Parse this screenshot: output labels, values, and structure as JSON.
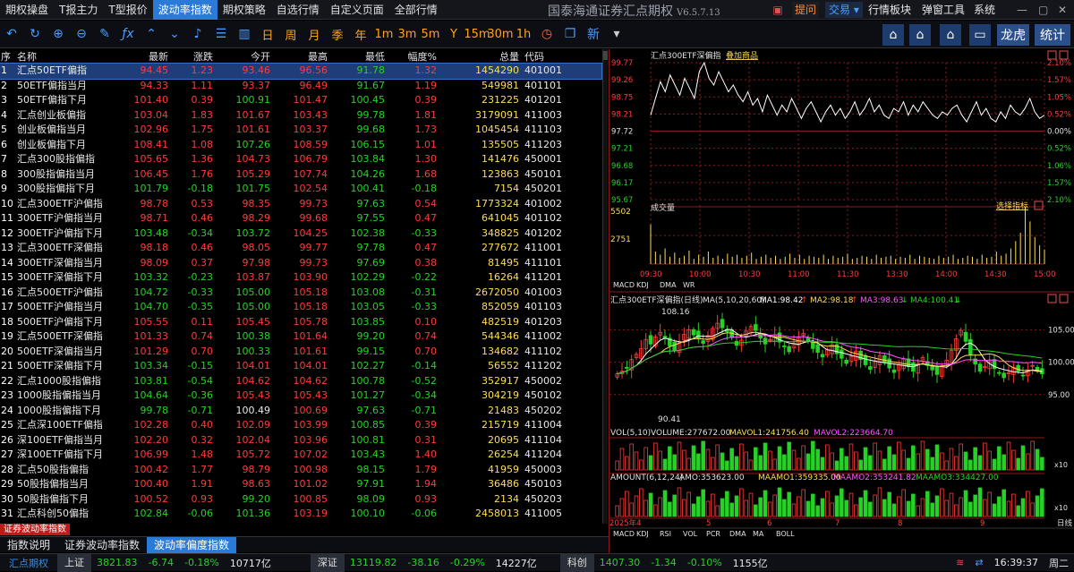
{
  "menubar": {
    "items": [
      "期权操盘",
      "T报主力",
      "T型报价",
      "波动率指数",
      "期权策略",
      "自选行情",
      "自定义页面",
      "全部行情"
    ],
    "active_index": 3
  },
  "app_title": {
    "name": "国泰海通证券汇点期权",
    "version": "V6.5.7.13"
  },
  "right_menu": {
    "tixing": "提问",
    "jiaoyi": "交易",
    "hangqing_bankuai": "行情板块",
    "tanchuang": "弹窗工具",
    "xitong": "系统"
  },
  "toolbar": {
    "periods": [
      "日",
      "周",
      "月",
      "季",
      "年",
      "1m",
      "3m",
      "5m",
      "Y",
      "15m",
      "30m",
      "1h"
    ],
    "xin_label": "新",
    "longhu_label": "龙虎",
    "tongji_label": "统计",
    "icons": [
      "undo-icon",
      "refresh-icon",
      "zoom-in-icon",
      "zoom-out-icon",
      "draw-icon",
      "formula-icon",
      "up-icon",
      "down-icon",
      "bell-icon",
      "list-icon",
      "chart-icon"
    ]
  },
  "table": {
    "headers": {
      "no": "序",
      "name": "名称",
      "last": "最新",
      "chg": "涨跌",
      "open": "今开",
      "high": "最高",
      "low": "最低",
      "pct": "幅度%",
      "vol": "总量",
      "code": "代码"
    },
    "rows": [
      {
        "no": "1",
        "name": "汇点50ETF偏指",
        "last": "94.45",
        "chg": "1.23",
        "open": "93.46",
        "high": "96.56",
        "low": "91.78",
        "pct": "1.32",
        "vol": "1454290",
        "code": "401001",
        "dir": "up",
        "o": "up",
        "h": "up",
        "l": "dn"
      },
      {
        "no": "2",
        "name": "50ETF偏指当月",
        "last": "94.33",
        "chg": "1.11",
        "open": "93.37",
        "high": "96.49",
        "low": "91.67",
        "pct": "1.19",
        "vol": "549981",
        "code": "401101",
        "dir": "up",
        "o": "up",
        "h": "up",
        "l": "dn"
      },
      {
        "no": "3",
        "name": "50ETF偏指下月",
        "last": "101.40",
        "chg": "0.39",
        "open": "100.91",
        "high": "101.47",
        "low": "100.45",
        "pct": "0.39",
        "vol": "231225",
        "code": "401201",
        "dir": "up",
        "o": "dn",
        "h": "up",
        "l": "dn"
      },
      {
        "no": "4",
        "name": "汇点创业板偏指",
        "last": "103.04",
        "chg": "1.83",
        "open": "101.67",
        "high": "103.43",
        "low": "99.78",
        "pct": "1.81",
        "vol": "3179091",
        "code": "411003",
        "dir": "up",
        "o": "up",
        "h": "up",
        "l": "dn"
      },
      {
        "no": "5",
        "name": "创业板偏指当月",
        "last": "102.96",
        "chg": "1.75",
        "open": "101.61",
        "high": "103.37",
        "low": "99.68",
        "pct": "1.73",
        "vol": "1045454",
        "code": "411103",
        "dir": "up",
        "o": "up",
        "h": "up",
        "l": "dn"
      },
      {
        "no": "6",
        "name": "创业板偏指下月",
        "last": "108.41",
        "chg": "1.08",
        "open": "107.26",
        "high": "108.59",
        "low": "106.15",
        "pct": "1.01",
        "vol": "135505",
        "code": "411203",
        "dir": "up",
        "o": "dn",
        "h": "up",
        "l": "dn"
      },
      {
        "no": "7",
        "name": "汇点300股指偏指",
        "last": "105.65",
        "chg": "1.36",
        "open": "104.73",
        "high": "106.79",
        "low": "103.84",
        "pct": "1.30",
        "vol": "141476",
        "code": "450001",
        "dir": "up",
        "o": "up",
        "h": "up",
        "l": "dn"
      },
      {
        "no": "8",
        "name": "300股指偏指当月",
        "last": "106.45",
        "chg": "1.76",
        "open": "105.29",
        "high": "107.74",
        "low": "104.26",
        "pct": "1.68",
        "vol": "123863",
        "code": "450101",
        "dir": "up",
        "o": "up",
        "h": "up",
        "l": "dn"
      },
      {
        "no": "9",
        "name": "300股指偏指下月",
        "last": "101.79",
        "chg": "-0.18",
        "open": "101.75",
        "high": "102.54",
        "low": "100.41",
        "pct": "-0.18",
        "vol": "7154",
        "code": "450201",
        "dir": "dn",
        "o": "dn",
        "h": "up",
        "l": "dn"
      },
      {
        "no": "10",
        "name": "汇点300ETF沪偏指",
        "last": "98.78",
        "chg": "0.53",
        "open": "98.35",
        "high": "99.73",
        "low": "97.63",
        "pct": "0.54",
        "vol": "1773324",
        "code": "401002",
        "dir": "up",
        "o": "up",
        "h": "up",
        "l": "dn"
      },
      {
        "no": "11",
        "name": "300ETF沪偏指当月",
        "last": "98.71",
        "chg": "0.46",
        "open": "98.29",
        "high": "99.68",
        "low": "97.55",
        "pct": "0.47",
        "vol": "641045",
        "code": "401102",
        "dir": "up",
        "o": "up",
        "h": "up",
        "l": "dn"
      },
      {
        "no": "12",
        "name": "300ETF沪偏指下月",
        "last": "103.48",
        "chg": "-0.34",
        "open": "103.72",
        "high": "104.25",
        "low": "102.38",
        "pct": "-0.33",
        "vol": "348825",
        "code": "401202",
        "dir": "dn",
        "o": "dn",
        "h": "up",
        "l": "dn"
      },
      {
        "no": "13",
        "name": "汇点300ETF深偏指",
        "last": "98.18",
        "chg": "0.46",
        "open": "98.05",
        "high": "99.77",
        "low": "97.78",
        "pct": "0.47",
        "vol": "277672",
        "code": "411001",
        "dir": "up",
        "o": "up",
        "h": "up",
        "l": "dn"
      },
      {
        "no": "14",
        "name": "300ETF深偏指当月",
        "last": "98.09",
        "chg": "0.37",
        "open": "97.98",
        "high": "99.73",
        "low": "97.69",
        "pct": "0.38",
        "vol": "81495",
        "code": "411101",
        "dir": "up",
        "o": "up",
        "h": "up",
        "l": "dn"
      },
      {
        "no": "15",
        "name": "300ETF深偏指下月",
        "last": "103.32",
        "chg": "-0.23",
        "open": "103.87",
        "high": "103.90",
        "low": "102.29",
        "pct": "-0.22",
        "vol": "16264",
        "code": "411201",
        "dir": "dn",
        "o": "up",
        "h": "up",
        "l": "dn"
      },
      {
        "no": "16",
        "name": "汇点500ETF沪偏指",
        "last": "104.72",
        "chg": "-0.33",
        "open": "105.00",
        "high": "105.18",
        "low": "103.08",
        "pct": "-0.31",
        "vol": "2672050",
        "code": "401003",
        "dir": "dn",
        "o": "dn",
        "h": "up",
        "l": "dn"
      },
      {
        "no": "17",
        "name": "500ETF沪偏指当月",
        "last": "104.70",
        "chg": "-0.35",
        "open": "105.00",
        "high": "105.18",
        "low": "103.05",
        "pct": "-0.33",
        "vol": "852059",
        "code": "401103",
        "dir": "dn",
        "o": "dn",
        "h": "up",
        "l": "dn"
      },
      {
        "no": "18",
        "name": "500ETF沪偏指下月",
        "last": "105.55",
        "chg": "0.11",
        "open": "105.45",
        "high": "105.78",
        "low": "103.85",
        "pct": "0.10",
        "vol": "482519",
        "code": "401203",
        "dir": "up",
        "o": "up",
        "h": "up",
        "l": "dn"
      },
      {
        "no": "19",
        "name": "汇点500ETF深偏指",
        "last": "101.33",
        "chg": "0.74",
        "open": "100.38",
        "high": "101.64",
        "low": "99.20",
        "pct": "0.74",
        "vol": "544346",
        "code": "411002",
        "dir": "up",
        "o": "dn",
        "h": "up",
        "l": "dn"
      },
      {
        "no": "20",
        "name": "500ETF深偏指当月",
        "last": "101.29",
        "chg": "0.70",
        "open": "100.33",
        "high": "101.61",
        "low": "99.15",
        "pct": "0.70",
        "vol": "134682",
        "code": "411102",
        "dir": "up",
        "o": "dn",
        "h": "up",
        "l": "dn"
      },
      {
        "no": "21",
        "name": "500ETF深偏指下月",
        "last": "103.34",
        "chg": "-0.15",
        "open": "104.01",
        "high": "104.01",
        "low": "102.27",
        "pct": "-0.14",
        "vol": "56552",
        "code": "411202",
        "dir": "dn",
        "o": "up",
        "h": "up",
        "l": "dn"
      },
      {
        "no": "22",
        "name": "汇点1000股指偏指",
        "last": "103.81",
        "chg": "-0.54",
        "open": "104.62",
        "high": "104.62",
        "low": "100.78",
        "pct": "-0.52",
        "vol": "352917",
        "code": "450002",
        "dir": "dn",
        "o": "up",
        "h": "up",
        "l": "dn"
      },
      {
        "no": "23",
        "name": "1000股指偏指当月",
        "last": "104.64",
        "chg": "-0.36",
        "open": "105.43",
        "high": "105.43",
        "low": "101.27",
        "pct": "-0.34",
        "vol": "304219",
        "code": "450102",
        "dir": "dn",
        "o": "up",
        "h": "up",
        "l": "dn"
      },
      {
        "no": "24",
        "name": "1000股指偏指下月",
        "last": "99.78",
        "chg": "-0.71",
        "open": "100.49",
        "high": "100.69",
        "low": "97.63",
        "pct": "-0.71",
        "vol": "21483",
        "code": "450202",
        "dir": "dn",
        "o": "eq",
        "h": "up",
        "l": "dn"
      },
      {
        "no": "25",
        "name": "汇点深100ETF偏指",
        "last": "102.28",
        "chg": "0.40",
        "open": "102.09",
        "high": "103.99",
        "low": "100.85",
        "pct": "0.39",
        "vol": "215719",
        "code": "411004",
        "dir": "up",
        "o": "up",
        "h": "up",
        "l": "dn"
      },
      {
        "no": "26",
        "name": "深100ETF偏指当月",
        "last": "102.20",
        "chg": "0.32",
        "open": "102.04",
        "high": "103.96",
        "low": "100.81",
        "pct": "0.31",
        "vol": "20695",
        "code": "411104",
        "dir": "up",
        "o": "up",
        "h": "up",
        "l": "dn"
      },
      {
        "no": "27",
        "name": "深100ETF偏指下月",
        "last": "106.99",
        "chg": "1.48",
        "open": "105.72",
        "high": "107.02",
        "low": "103.43",
        "pct": "1.40",
        "vol": "26254",
        "code": "411204",
        "dir": "up",
        "o": "up",
        "h": "up",
        "l": "dn"
      },
      {
        "no": "28",
        "name": "汇点50股指偏指",
        "last": "100.42",
        "chg": "1.77",
        "open": "98.79",
        "high": "100.98",
        "low": "98.15",
        "pct": "1.79",
        "vol": "41959",
        "code": "450003",
        "dir": "up",
        "o": "up",
        "h": "up",
        "l": "dn"
      },
      {
        "no": "29",
        "name": "50股指偏指当月",
        "last": "100.40",
        "chg": "1.91",
        "open": "98.63",
        "high": "101.02",
        "low": "97.91",
        "pct": "1.94",
        "vol": "36486",
        "code": "450103",
        "dir": "up",
        "o": "up",
        "h": "up",
        "l": "dn"
      },
      {
        "no": "30",
        "name": "50股指偏指下月",
        "last": "100.52",
        "chg": "0.93",
        "open": "99.20",
        "high": "100.85",
        "low": "98.09",
        "pct": "0.93",
        "vol": "2134",
        "code": "450203",
        "dir": "up",
        "o": "dn",
        "h": "up",
        "l": "dn"
      },
      {
        "no": "31",
        "name": "汇点科创50偏指",
        "last": "102.84",
        "chg": "-0.06",
        "open": "101.36",
        "high": "103.19",
        "low": "100.10",
        "pct": "-0.06",
        "vol": "2458013",
        "code": "411005",
        "dir": "dn",
        "o": "dn",
        "h": "up",
        "l": "dn"
      }
    ]
  },
  "bottom_tab": "证券波动率指数",
  "info_tabs": [
    "指数说明",
    "证券波动率指数",
    "波动率偏度指数"
  ],
  "info_tabs_active": 2,
  "statusbar": {
    "logo": "汇点期权",
    "markets": [
      {
        "label": "上证",
        "value": "3821.83",
        "chg": "-6.74",
        "pct": "-0.18%",
        "amount": "10717亿"
      },
      {
        "label": "深证",
        "value": "13119.82",
        "chg": "-38.16",
        "pct": "-0.29%",
        "amount": "14227亿"
      },
      {
        "label": "科创",
        "value": "1407.30",
        "chg": "-1.34",
        "pct": "-0.10%",
        "amount": "1155亿"
      }
    ],
    "time": "16:39:37",
    "weekday": "周二"
  },
  "intraday": {
    "title": "汇点300ETF深偏指",
    "add_label": "叠加商品",
    "y_labels": [
      "99.77",
      "99.26",
      "98.75",
      "98.21",
      "97.72",
      "97.21",
      "96.68",
      "96.17",
      "95.67"
    ],
    "y_pct_labels": [
      "2.10%",
      "1.57%",
      "1.05%",
      "0.52%",
      "0.00%",
      "0.52%",
      "1.06%",
      "1.57%",
      "2.10%"
    ],
    "price": [
      98.2,
      98.7,
      99.2,
      98.9,
      99.4,
      99.1,
      98.8,
      99.3,
      99.0,
      98.7,
      99.5,
      99.77,
      99.3,
      99.1,
      99.5,
      99.2,
      98.9,
      99.1,
      98.8,
      98.6,
      98.9,
      98.5,
      98.7,
      98.3,
      98.8,
      98.5,
      98.2,
      98.5,
      98.3,
      98.7,
      98.4,
      98.1,
      98.4,
      98.6,
      98.3,
      98.0,
      98.3,
      98.5,
      98.2,
      98.4,
      98.1,
      98.3,
      98.6,
      98.2,
      98.4,
      98.7,
      98.3,
      98.5,
      98.2,
      98.1,
      98.4,
      98.3,
      98.6,
      98.2,
      98.5,
      98.3,
      98.6,
      98.4,
      98.2,
      98.1,
      98.3,
      98.2,
      98.4,
      98.5,
      98.2,
      98.0,
      98.3,
      98.6,
      98.2,
      98.4,
      98.1,
      98.0,
      98.3,
      98.1,
      98.5,
      98.3,
      98.2,
      98.4,
      98.7,
      98.3,
      98.1,
      98.2
    ],
    "vol_title": "成交量",
    "vol_select": "选择指标",
    "vol_max": "5502",
    "vol_mid": "2751",
    "vol_values": [
      3800,
      1200,
      900,
      1500,
      700,
      1100,
      600,
      800,
      1300,
      500,
      900,
      700,
      1200,
      600,
      800,
      500,
      1000,
      700,
      900,
      600,
      800,
      1100,
      500,
      700,
      900,
      600,
      800,
      500,
      700,
      1000,
      600,
      900,
      500,
      800,
      700,
      600,
      900,
      500,
      800,
      600,
      700,
      1000,
      500,
      600,
      800,
      700,
      500,
      900,
      600,
      700,
      800,
      500,
      700,
      600,
      900,
      500,
      800,
      700,
      600,
      500,
      800,
      600,
      700,
      900,
      500,
      600,
      800,
      700,
      500,
      900,
      600,
      700,
      1200,
      800,
      1000,
      1500,
      2200,
      3000,
      5502,
      4100,
      2600,
      1800,
      1400
    ],
    "time_labels": [
      "09:30",
      "10:00",
      "10:30",
      "11:00",
      "11:30",
      "13:30",
      "14:00",
      "14:30",
      "15:00"
    ],
    "sub_tabs": [
      "MACD",
      "KDJ",
      "DMA",
      "WR"
    ]
  },
  "kline": {
    "title": "汇点300ETF深偏指(日线)",
    "ma_label": "MA(5,10,20,60)",
    "ma1": "MA1:98.42",
    "ma2": "MA2:98.18",
    "ma3": "MA3:98.63",
    "ma4": "MA4:100.41",
    "high_mark": "108.16",
    "low_mark": "90.41",
    "y_labels": [
      "105.00",
      "100.00",
      "95.00"
    ],
    "vol_title": "VOL(5,10)",
    "volume": "VOLUME:277672.00",
    "mavol1": "MAVOL1:241756.40",
    "mavol2": "MAVOL2:223664.70",
    "vol_unit": "x10",
    "amount_title": "AMOUNT(6,12,24)",
    "amo": "AMO:353623.00",
    "maamo1": "MAAMO1:359335.00",
    "maamo2": "MAAMO2:353241.82",
    "maamo3": "MAAMO3:334427.00",
    "amount_unit": "x10",
    "date_labels": [
      "2025年4",
      "5",
      "6",
      "7",
      "8",
      "9",
      "日线"
    ],
    "sub_tabs": [
      "MACD",
      "KDJ",
      "RSI",
      "VOL",
      "PCR",
      "DMA",
      "MA",
      "BOLL"
    ],
    "closes": [
      98.2,
      98.6,
      99.1,
      100.4,
      101.2,
      102.1,
      103.5,
      102.8,
      103.9,
      104.6,
      103.7,
      102.5,
      101.8,
      103.1,
      104.3,
      105.0,
      104.2,
      103.6,
      102.9,
      104.1,
      105.2,
      106.0,
      105.3,
      104.7,
      103.8,
      102.6,
      103.4,
      104.8,
      105.5,
      104.9,
      103.7,
      102.8,
      103.5,
      104.2,
      103.1,
      102.4,
      101.6,
      102.9,
      103.8,
      104.4,
      103.2,
      102.1,
      101.5,
      100.8,
      101.9,
      102.7,
      101.3,
      100.6,
      99.8,
      100.9,
      101.7,
      100.4,
      99.6,
      98.9,
      100.2,
      101.0,
      99.9,
      99.1,
      98.4,
      99.6,
      100.5,
      99.3,
      98.6,
      99.8,
      100.7,
      99.5,
      98.8,
      98.1,
      99.4,
      100.3,
      101.8,
      103.6,
      104.9,
      103.2,
      101.1,
      99.7,
      98.6,
      99.3,
      100.1,
      99.0,
      98.3,
      97.6,
      98.4,
      99.2,
      98.6,
      97.9,
      98.8,
      99.5,
      98.7,
      98.2
    ]
  },
  "colors": {
    "up": "#ff3b3b",
    "down": "#27d127",
    "accent": "#2a7ad8",
    "volume": "#ffdd55",
    "price_line": "#ffffff"
  }
}
